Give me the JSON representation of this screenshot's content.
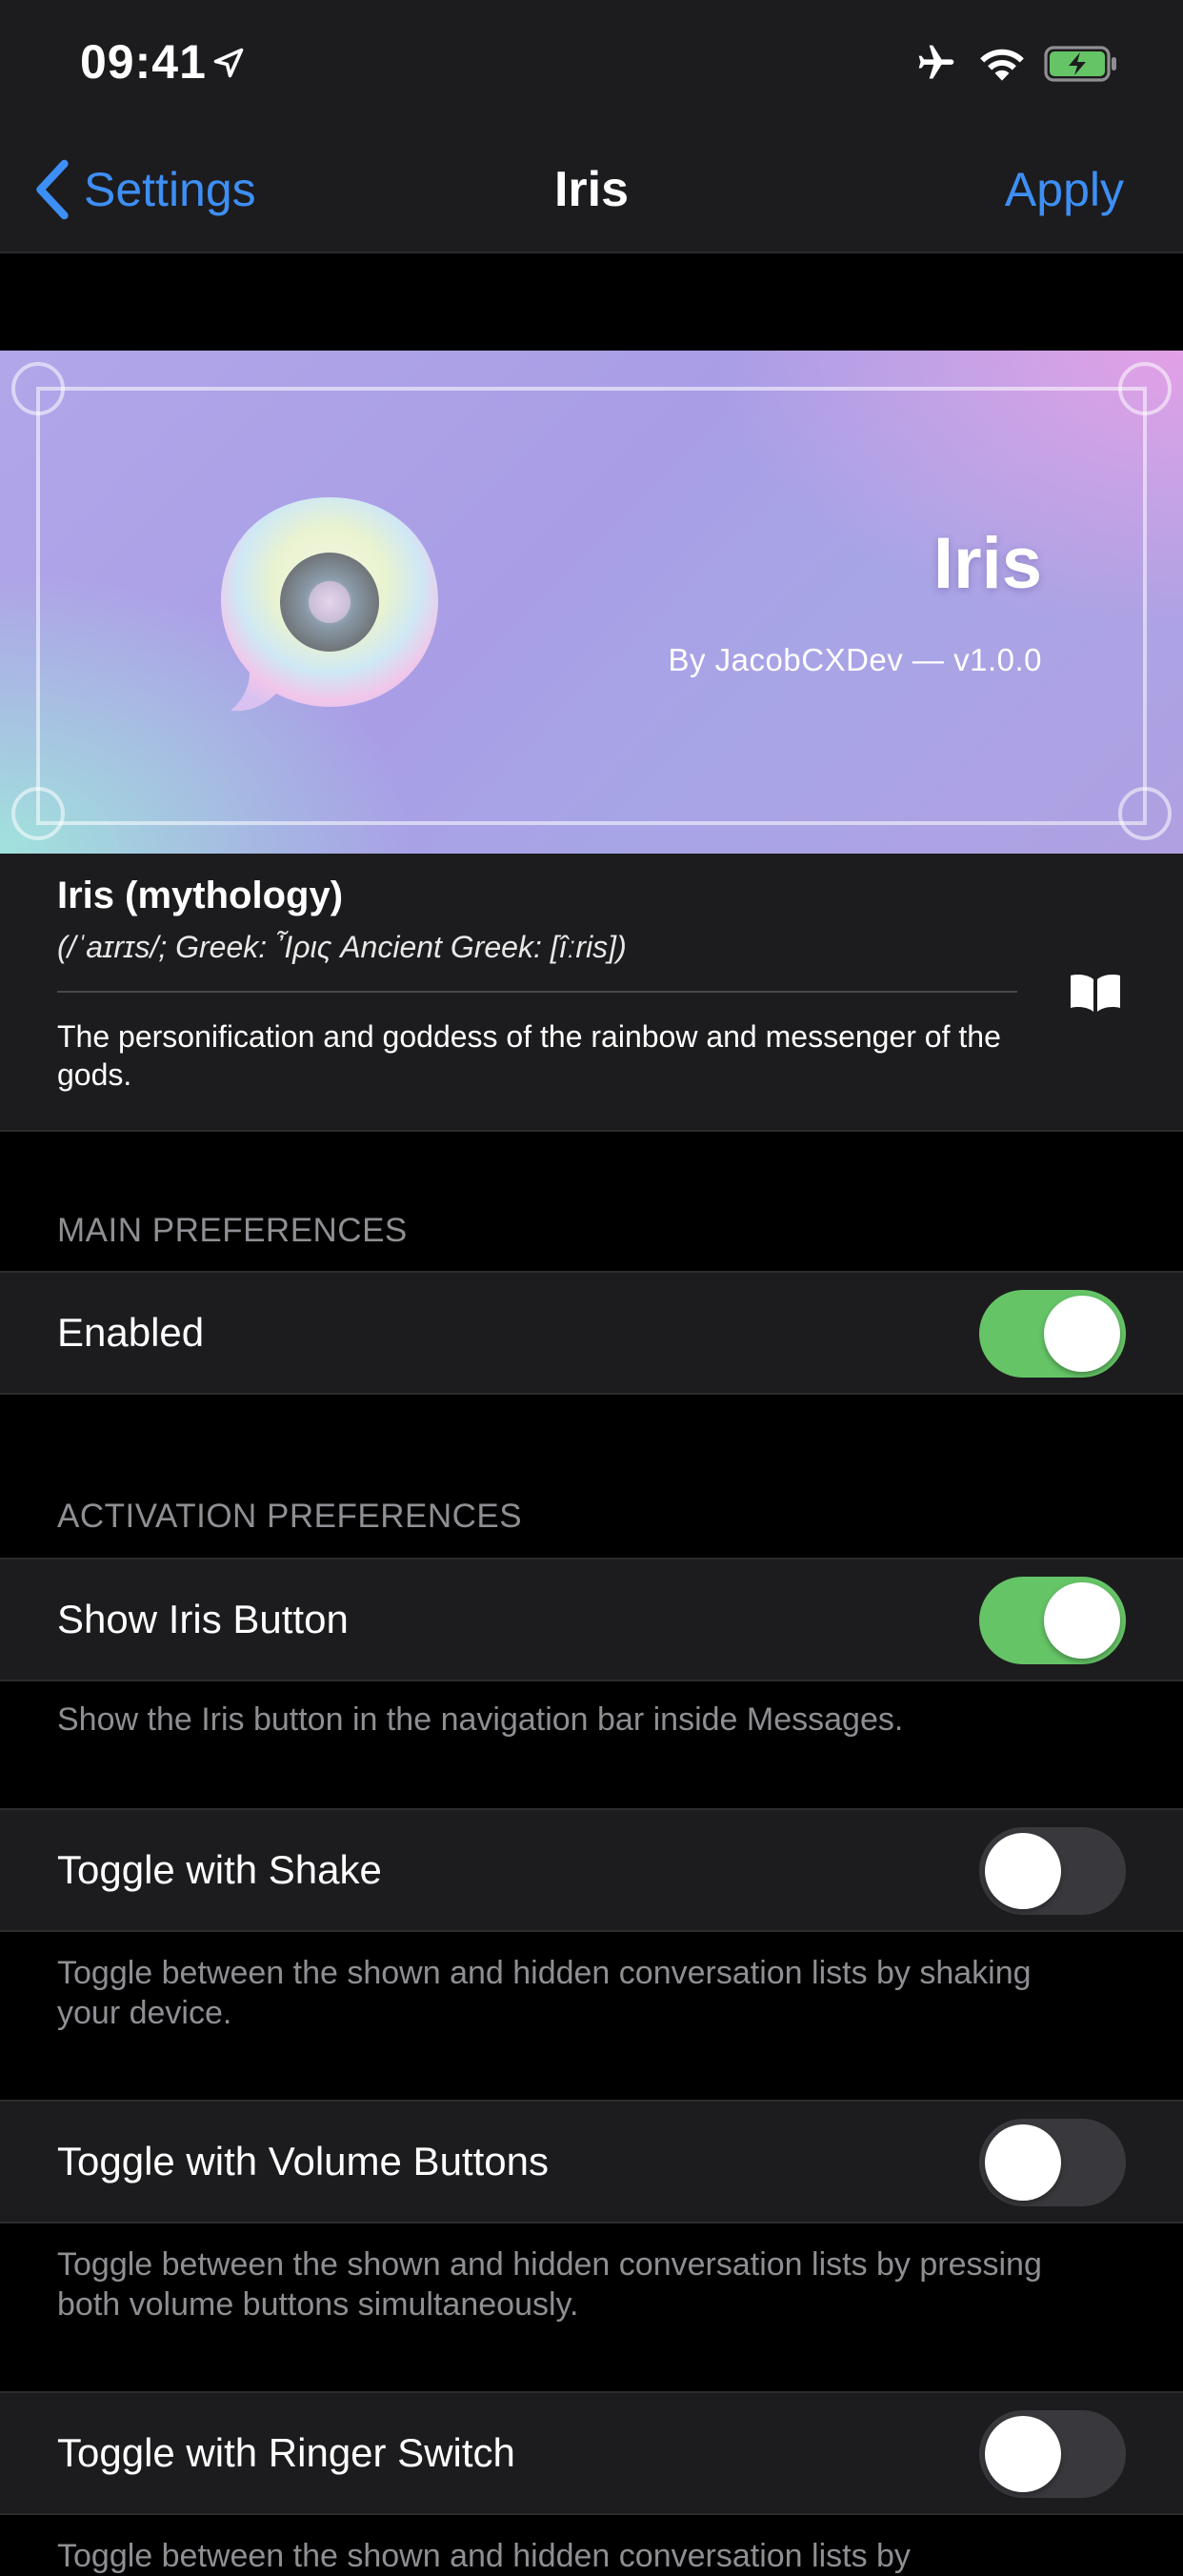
{
  "status_bar": {
    "time": "09:41"
  },
  "nav": {
    "back_label": "Settings",
    "title": "Iris",
    "apply_label": "Apply"
  },
  "banner": {
    "title": "Iris",
    "subtitle": "By JacobCXDev — v1.0.0"
  },
  "mythology": {
    "title": "Iris (mythology)",
    "pronunciation": "(/ˈaɪrɪs/; Greek: Ἶρις Ancient Greek: [îːris])",
    "description": "The personification and goddess of the rainbow and messenger of the gods."
  },
  "sections": {
    "main_header": "MAIN PREFERENCES",
    "activation_header": "ACTIVATION PREFERENCES"
  },
  "cells": [
    {
      "label": "Enabled",
      "on": true
    },
    {
      "label": "Show Iris Button",
      "on": true,
      "footer": "Show the Iris button in the navigation bar inside Messages."
    },
    {
      "label": "Toggle with Shake",
      "on": false,
      "footer": "Toggle between the shown and hidden conversation lists by shaking your device."
    },
    {
      "label": "Toggle with Volume Buttons",
      "on": false,
      "footer": "Toggle between the shown and hidden conversation lists by pressing both volume buttons simultaneously."
    },
    {
      "label": "Toggle with Ringer Switch",
      "on": false,
      "footer": "Toggle between the shown and hidden conversation lists by"
    }
  ],
  "colors": {
    "accent": "#3e8ff5",
    "switch_on": "#65c466",
    "switch_off": "#39393d",
    "cell_bg": "#1c1c1e",
    "footer_text": "#8e8e93"
  },
  "icons": [
    "location-arrow-icon",
    "airplane-icon",
    "wifi-icon",
    "battery-charging-icon",
    "chevron-left-icon",
    "app-icon",
    "book-icon"
  ]
}
